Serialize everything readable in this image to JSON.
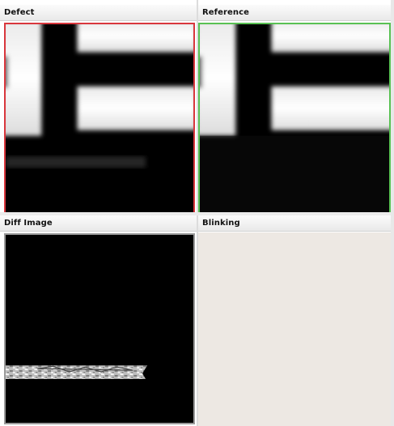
{
  "panels": {
    "defect": {
      "title": "Defect",
      "border_color": "#d9373d"
    },
    "reference": {
      "title": "Reference",
      "border_color": "#59c153"
    },
    "diff": {
      "title": "Diff Image",
      "border_color": "#9a9a9a"
    },
    "blinking": {
      "title": "Blinking",
      "background_color": "#ede8e3"
    }
  }
}
